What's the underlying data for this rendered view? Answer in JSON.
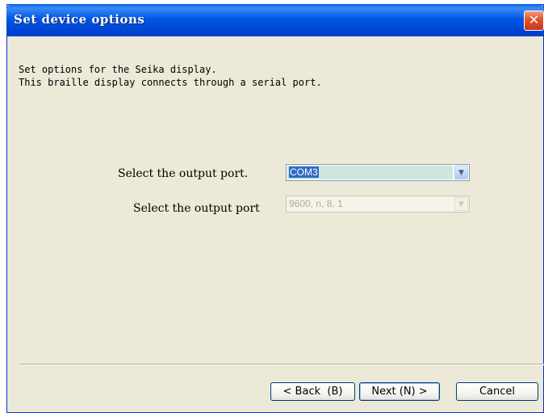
{
  "window": {
    "title": "Set device options"
  },
  "intro": {
    "line1": "Set options for the Seika display.",
    "line2": "This braille display connects through a serial port."
  },
  "port": {
    "label": "Select the output port.",
    "value": "COM3"
  },
  "port_settings": {
    "label": "Select the output port",
    "value": "9600, n, 8, 1"
  },
  "buttons": {
    "back": "< Back  (B)",
    "next": "Next (N) >",
    "cancel": "Cancel"
  },
  "icons": {
    "close": "close-icon",
    "dropdown": "chevron-down-icon"
  },
  "colors": {
    "titlebar": "#0058E6",
    "dialog_bg": "#ECE9D8",
    "selection": "#316AC5"
  }
}
